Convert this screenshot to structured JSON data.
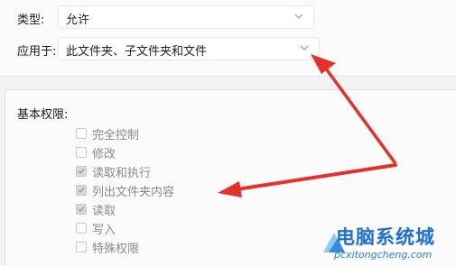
{
  "header": {
    "type_label": "类型:",
    "type_value": "允许",
    "applies_label": "应用于:",
    "applies_value": "此文件夹、子文件夹和文件"
  },
  "permissions": {
    "title": "基本权限:",
    "items": [
      {
        "label": "完全控制",
        "checked": false
      },
      {
        "label": "修改",
        "checked": false
      },
      {
        "label": "读取和执行",
        "checked": true
      },
      {
        "label": "列出文件夹内容",
        "checked": true
      },
      {
        "label": "读取",
        "checked": true
      },
      {
        "label": "写入",
        "checked": false
      },
      {
        "label": "特殊权限",
        "checked": false
      }
    ]
  },
  "annotation": {
    "arrow_color": "#e8302b",
    "arrow_targets": [
      "applies-to-dropdown",
      "perm-item-list-folder"
    ]
  },
  "watermark": {
    "title": "电脑系统城",
    "subtitle": "pcxitongcheng.com",
    "color": "#1f6fd1"
  },
  "icons": {
    "dropdown": "chevron-down-icon",
    "check": "check-icon",
    "logo": "triangle-logo-icon"
  }
}
